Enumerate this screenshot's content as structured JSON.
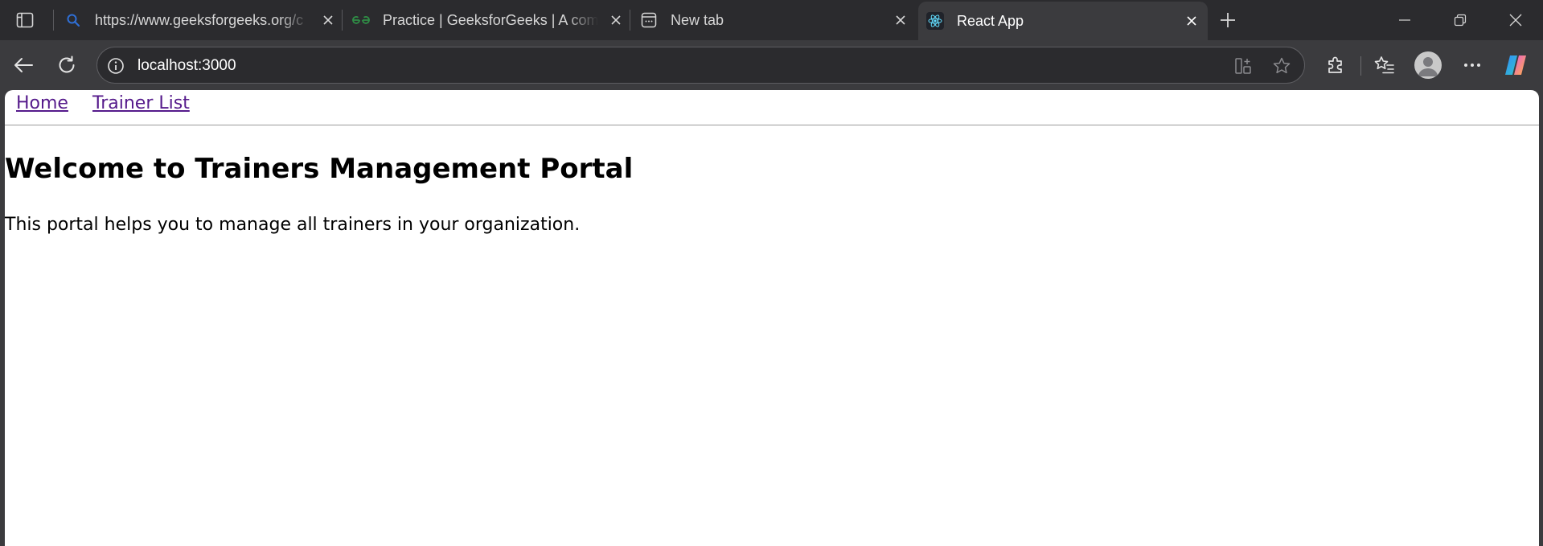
{
  "browser": {
    "tabs": [
      {
        "title": "https://www.geeksforgeeks.org/c",
        "icon": "search-icon",
        "active": false
      },
      {
        "title": "Practice | GeeksforGeeks | A comp",
        "icon": "gfg-logo-icon",
        "active": false
      },
      {
        "title": "New tab",
        "icon": "new-tab-page-icon",
        "active": false
      },
      {
        "title": "React App",
        "icon": "react-logo-icon",
        "active": true
      }
    ],
    "address_bar": {
      "url": "localhost:3000"
    },
    "colors": {
      "frame": "#2b2b2e",
      "toolbar": "#3b3b3e",
      "text": "#d6d6d6"
    }
  },
  "page": {
    "nav": {
      "home": "Home",
      "trainer_list": "Trainer List"
    },
    "title": "Welcome to Trainers Management Portal",
    "description": "This portal helps you to manage all trainers in your organization.",
    "colors": {
      "link": "#551a8b",
      "text": "#000000",
      "background": "#ffffff"
    }
  }
}
